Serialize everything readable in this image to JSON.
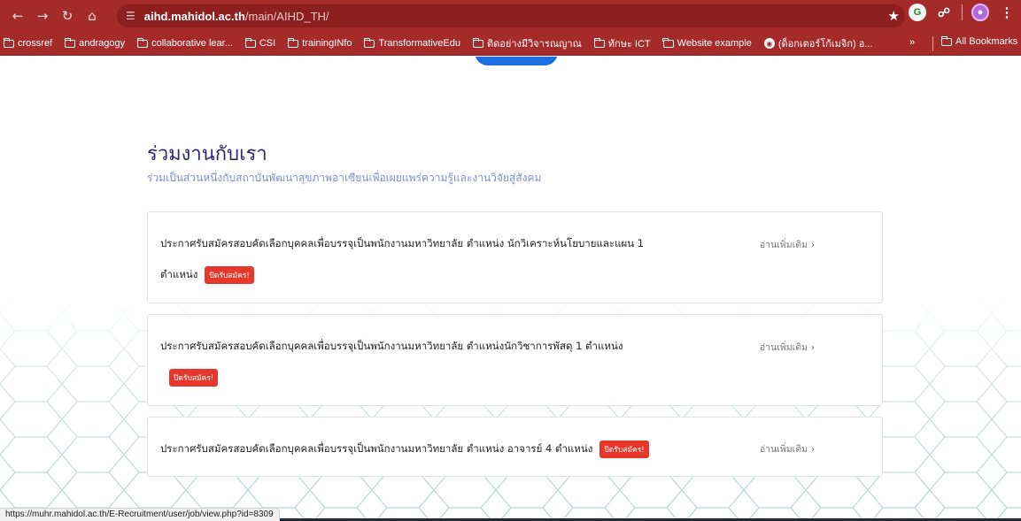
{
  "browser": {
    "url_host": "aihd.mahidol.ac.th",
    "url_path": "/main/AIHD_TH/",
    "bookmarks": [
      "crossref",
      "andragogy",
      "collaborative lear...",
      "CSI",
      "trainingINfo",
      "TransformativeEdu",
      "ติดอย่างมีวิจารณญาณ",
      "ทักษะ ICT",
      "Website example",
      "(ด็อกเตอร์โก้เมจิก) อ..."
    ],
    "bookmarks_more": "»",
    "all_bookmarks": "All Bookmarks",
    "ext_g": "G",
    "status_url": "https://muhr.mahidol.ac.th/E-Recruitment/user/job/view.php?id=8309"
  },
  "section": {
    "title": "ร่วมงานกับเรา",
    "subtitle": "ร่วมเป็นส่วนหนึ่งกับสถาบันพัฒนาสุขภาพอาเซียนเพื่อเผยแพร่ความรู้และงานวิจัยสู่สังคม"
  },
  "jobs": [
    {
      "title_line1": "ประกาศรับสมัครสอบคัดเลือกบุคคลเพื่อบรรจุเป็นพนักงานมหาวิทยาลัย ตำแหน่ง นักวิเคราะห์นโยบายและแผน 1",
      "title_line2": "ตำแหน่ง",
      "badge": "ปิดรับสมัคร!",
      "more": "อ่านเพิ่มเติม"
    },
    {
      "title_line1": "ประกาศรับสมัครสอบคัดเลือกบุคคลเพื่อบรรจุเป็นพนักงานมหาวิทยาลัย ตำแหน่งนักวิชาการพัสดุ 1 ตำแหน่ง",
      "badge": "ปิดรับสมัคร!",
      "more": "อ่านเพิ่มเติม"
    },
    {
      "title_line1": "ประกาศรับสมัครสอบคัดเลือกบุคคลเพื่อบรรจุเป็นพนักงานมหาวิทยาลัย ตำแหน่ง อาจารย์ 4 ตำแหน่ง",
      "badge": "ปิดรับสมัคร!",
      "more": "อ่านเพิ่มเติม"
    }
  ],
  "colors": {
    "chrome": "#a52a2a",
    "heading": "#2b2a6e",
    "subheading": "#7f8fcf",
    "badge": "#e7372a",
    "accent_blue": "#1b6fe0"
  }
}
